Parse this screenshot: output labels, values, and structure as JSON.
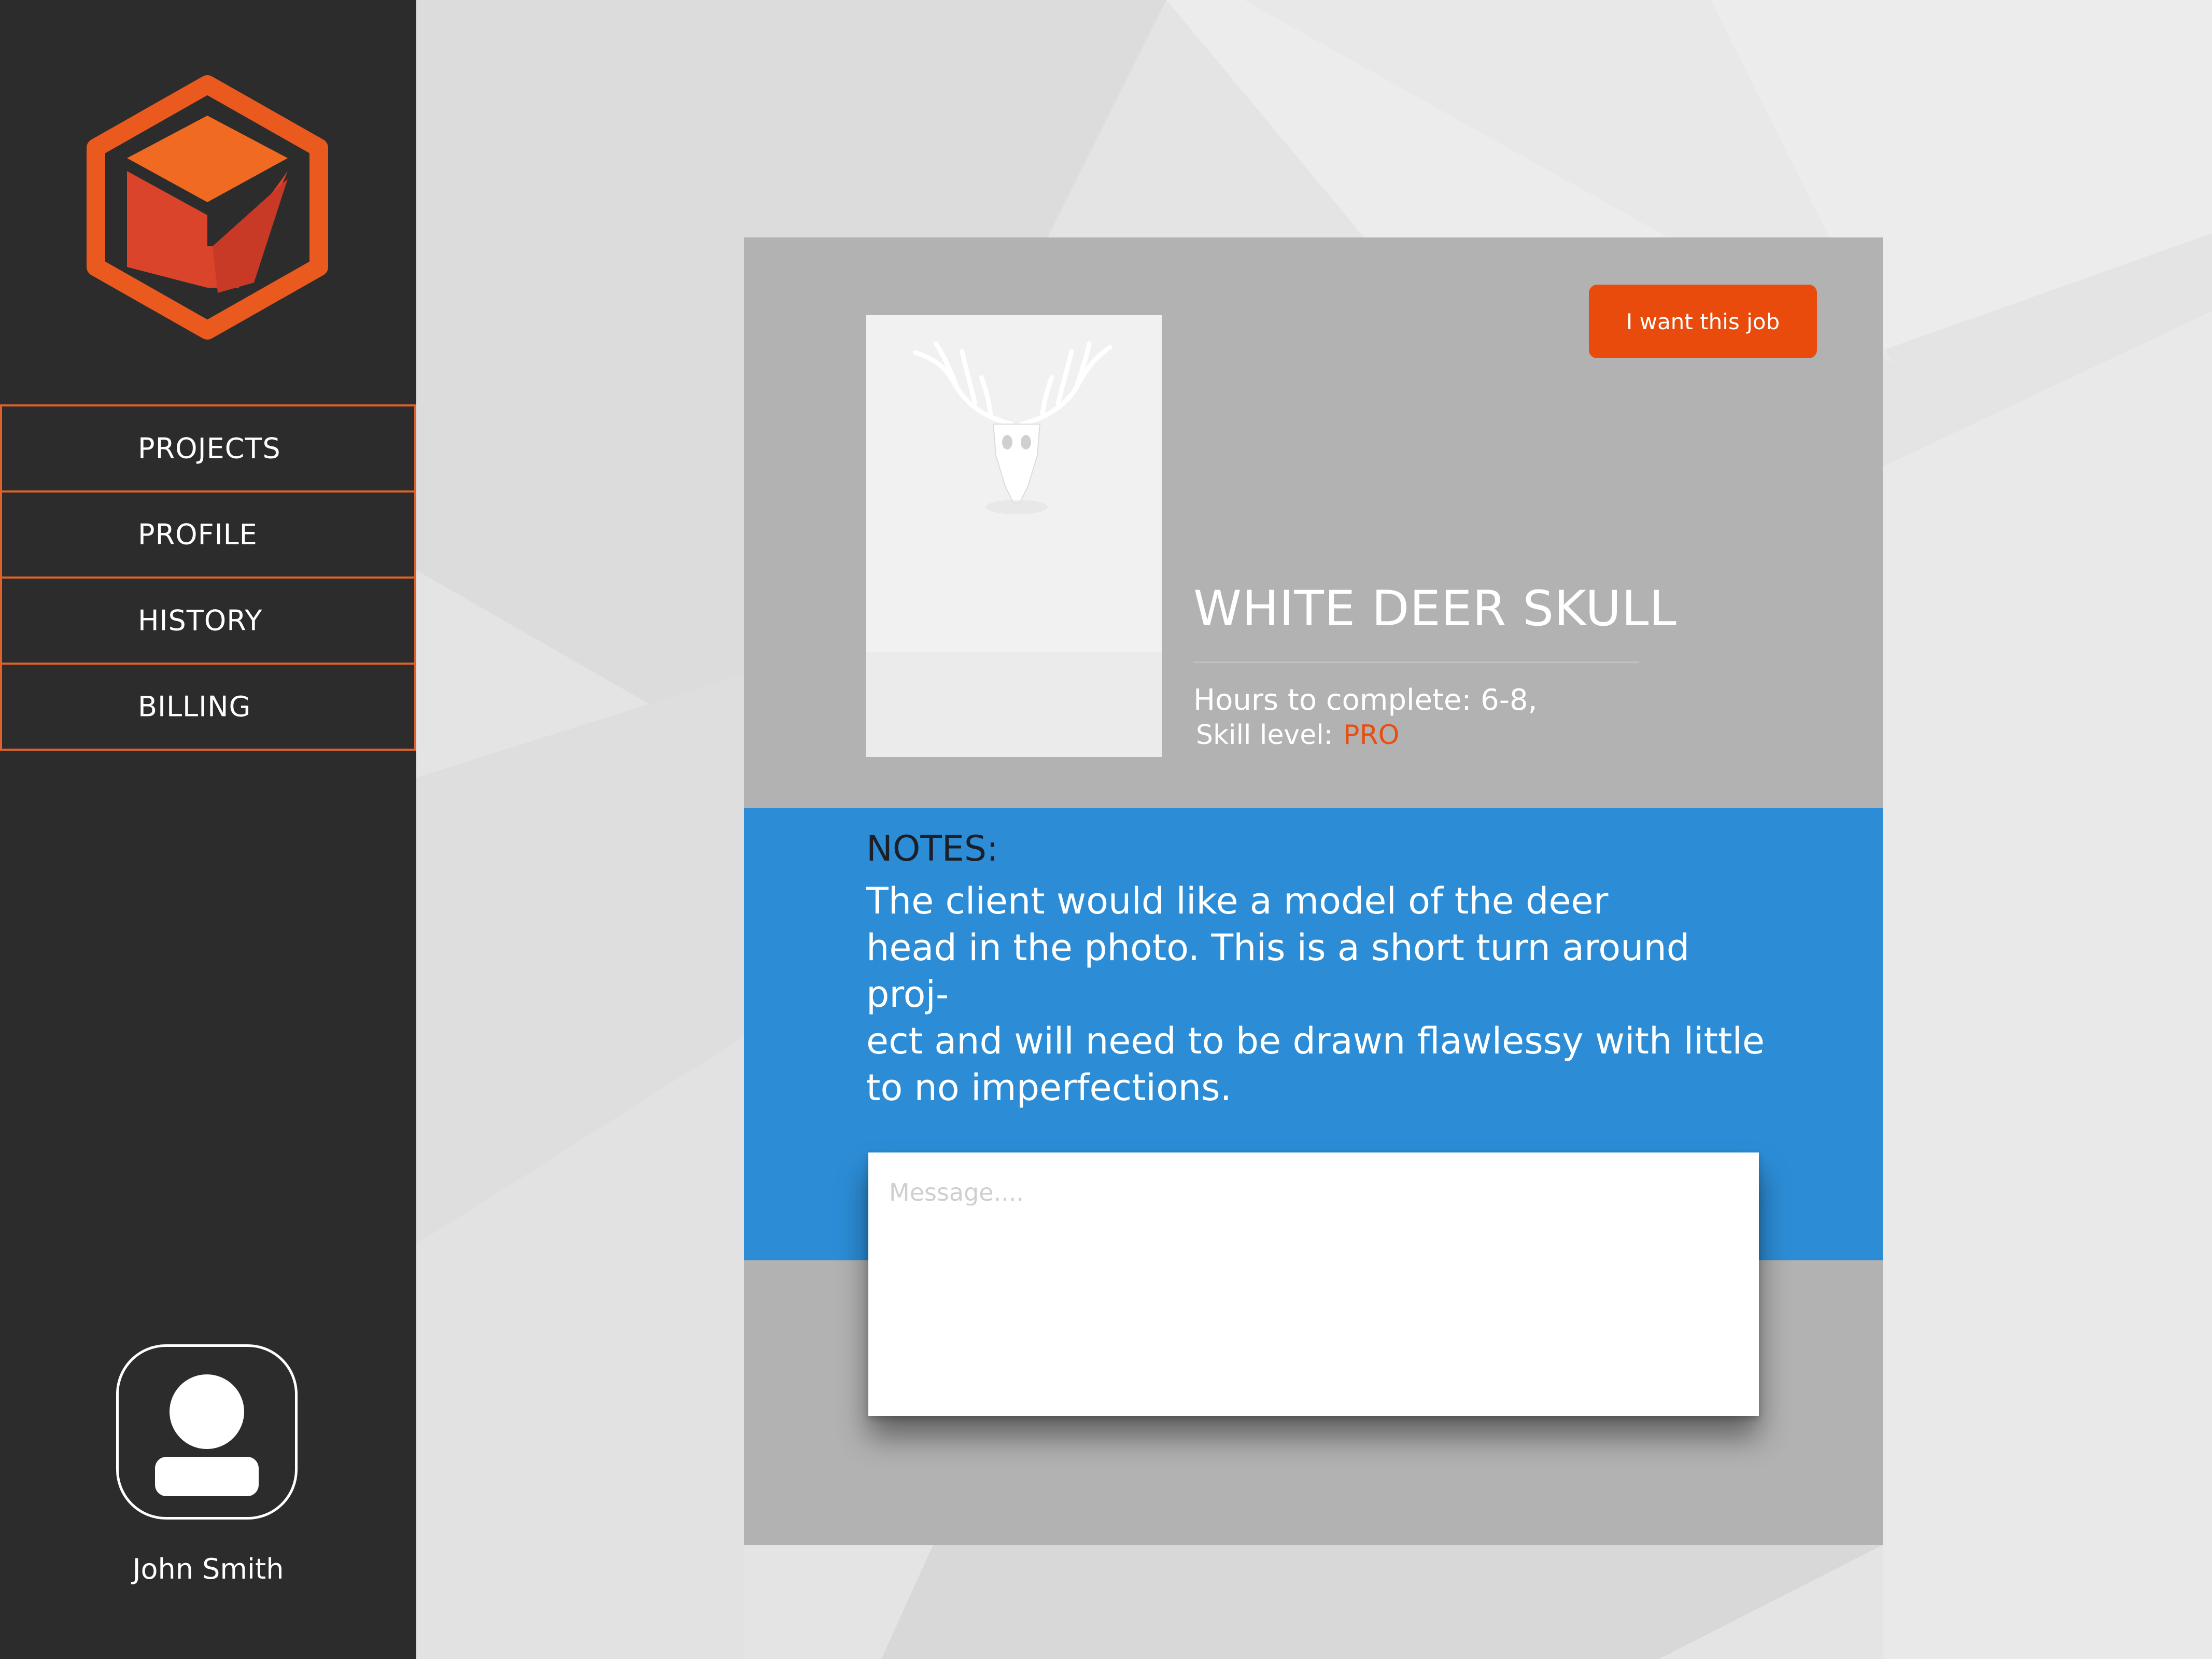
{
  "colors": {
    "sidebar_bg": "#2c2c2c",
    "accent_orange": "#e94b0c",
    "notes_blue": "#2c8dd6",
    "card_gray": "#b2b2b2"
  },
  "sidebar": {
    "logo_icon": "hexagon-cube-logo",
    "items": [
      {
        "label": "PROJECTS"
      },
      {
        "label": "PROFILE"
      },
      {
        "label": "HISTORY"
      },
      {
        "label": "BILLING"
      }
    ],
    "user": {
      "avatar_icon": "user-avatar-icon",
      "name": "John Smith"
    }
  },
  "job": {
    "action_label": "I want this job",
    "photo_icon": "deer-skull-photo",
    "title": "WHITE DEER SKULL",
    "hours": "Hours to complete: 6-8,",
    "skill_label": "Skill level:",
    "skill_value": "PRO",
    "notes_title": "NOTES:",
    "notes_body": "The client would like a model of the deer\nhead in the photo. This is a short turn around proj-\nect and will need to be drawn flawlessy with little\nto no imperfections.",
    "message_placeholder": "Message...."
  }
}
